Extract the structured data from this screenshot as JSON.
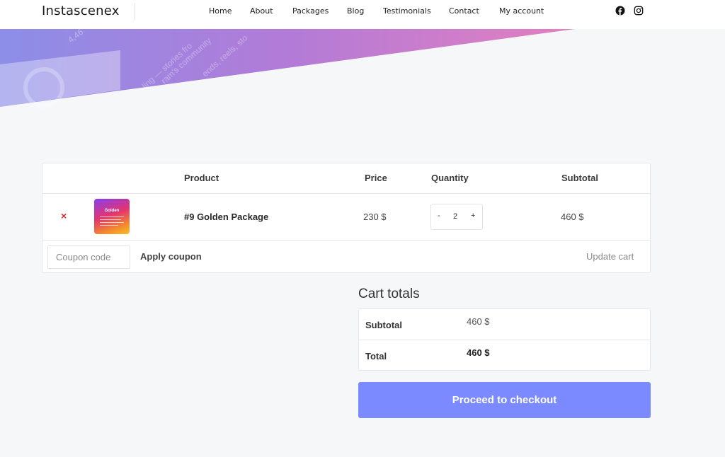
{
  "header": {
    "logo": "Instascenex",
    "nav": [
      "Home",
      "About",
      "Packages",
      "Blog",
      "Testimonials",
      "Contact",
      "My account"
    ],
    "social": [
      "facebook-icon",
      "instagram-icon"
    ]
  },
  "hero": {
    "colors": {
      "start": "#8c8ee8",
      "mid": "#b27bd7",
      "end": "#e27fc0"
    },
    "faded_text": [
      "4,46",
      "ling — stories fro",
      "ram's community",
      "ends, reels, sto"
    ]
  },
  "cart": {
    "headers": {
      "product": "Product",
      "price": "Price",
      "quantity": "Quantity",
      "subtotal": "Subtotal"
    },
    "items": [
      {
        "remove": "×",
        "thumb_text": "Golden",
        "name": "#9 Golden Package",
        "price": "230 $",
        "qty_minus": "-",
        "quantity": "2",
        "qty_plus": "+",
        "subtotal": "460 $"
      }
    ],
    "coupon_placeholder": "Coupon code",
    "apply_coupon": "Apply coupon",
    "update_cart": "Update cart"
  },
  "totals": {
    "title": "Cart totals",
    "subtotal_label": "Subtotal",
    "subtotal_value": "460 $",
    "total_label": "Total",
    "total_value": "460 $",
    "checkout_label": "Proceed to checkout"
  },
  "colors": {
    "accent": "#7b8bff",
    "remove": "#e02b2b"
  }
}
